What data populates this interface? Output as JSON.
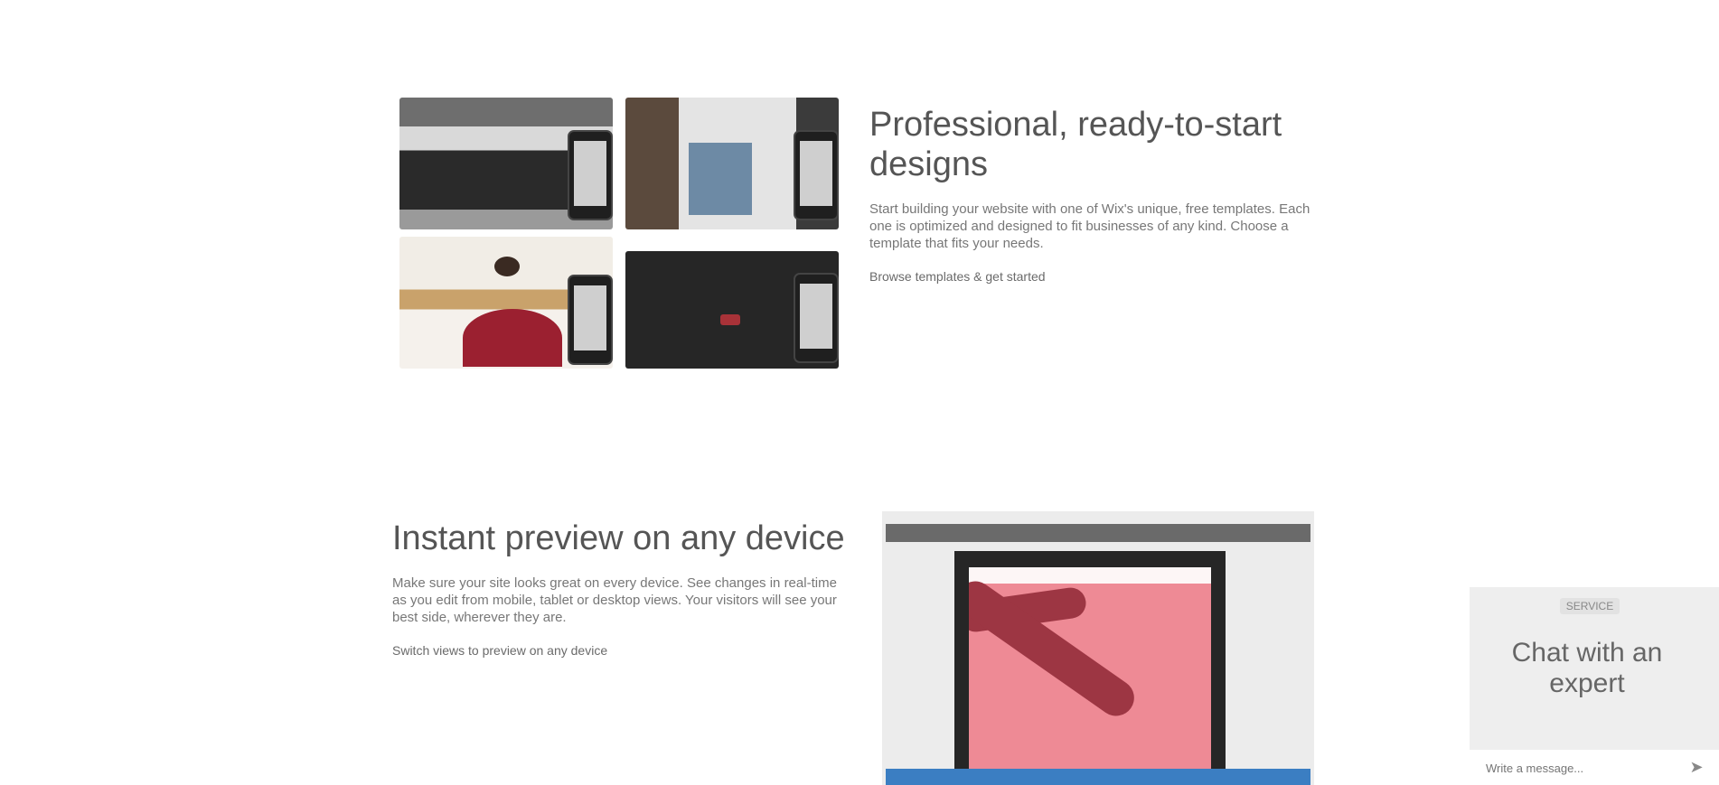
{
  "section_designs": {
    "heading": "Professional, ready-to-start designs",
    "description": "Start building your website with one of Wix's unique, free templates. Each one is optimized and designed to fit businesses of any kind. Choose a template that fits your needs.",
    "link_label": "Browse templates & get started"
  },
  "section_preview": {
    "heading": "Instant preview on any device",
    "description": "Make sure your site looks great on every device. See changes in real-time as you edit from mobile, tablet or desktop views. Your visitors will see your best side, wherever they are.",
    "link_label": "Switch views to preview on any device"
  },
  "chat_widget": {
    "badge": "SERVICE",
    "title": "Chat with an expert",
    "input_placeholder": "Write a message...",
    "send_icon": "send-icon"
  }
}
